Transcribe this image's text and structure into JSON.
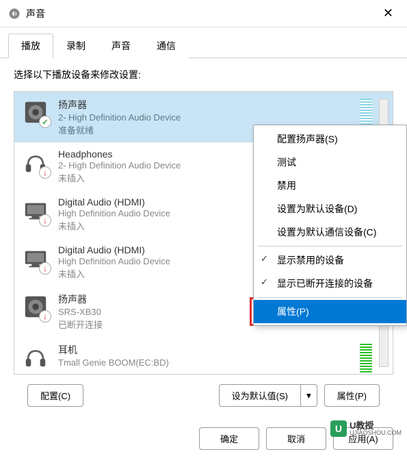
{
  "titlebar": {
    "title": "声音"
  },
  "tabs": [
    {
      "label": "播放",
      "active": true
    },
    {
      "label": "录制",
      "active": false
    },
    {
      "label": "声音",
      "active": false
    },
    {
      "label": "通信",
      "active": false
    }
  ],
  "instruction": "选择以下播放设备来修改设置:",
  "devices": [
    {
      "name": "扬声器",
      "desc": "2- High Definition Audio Device",
      "status": "准备就绪",
      "selected": true,
      "icon": "speaker",
      "level": "cyan",
      "badge": "green"
    },
    {
      "name": "Headphones",
      "desc": "2- High Definition Audio Device",
      "status": "未插入",
      "selected": false,
      "icon": "headphones",
      "level": null,
      "badge": "red"
    },
    {
      "name": "Digital Audio (HDMI)",
      "desc": "High Definition Audio Device",
      "status": "未插入",
      "selected": false,
      "icon": "monitor",
      "level": null,
      "badge": "red"
    },
    {
      "name": "Digital Audio (HDMI)",
      "desc": "High Definition Audio Device",
      "status": "未插入",
      "selected": false,
      "icon": "monitor",
      "level": null,
      "badge": "red"
    },
    {
      "name": "扬声器",
      "desc": "SRS-XB30",
      "status": "已断开连接",
      "selected": false,
      "icon": "speaker",
      "level": null,
      "badge": "red"
    },
    {
      "name": "耳机",
      "desc": "Tmall Genie BOOM(EC:BD)",
      "status": "",
      "selected": false,
      "icon": "headphones",
      "level": "green",
      "badge": null
    }
  ],
  "context_menu": {
    "items": [
      {
        "label": "配置扬声器(S)",
        "type": "item"
      },
      {
        "label": "测试",
        "type": "item"
      },
      {
        "label": "禁用",
        "type": "item"
      },
      {
        "label": "设置为默认设备(D)",
        "type": "item"
      },
      {
        "label": "设置为默认通信设备(C)",
        "type": "item"
      },
      {
        "type": "sep"
      },
      {
        "label": "显示禁用的设备",
        "type": "item",
        "checked": true
      },
      {
        "label": "显示已断开连接的设备",
        "type": "item",
        "checked": true
      },
      {
        "type": "sep"
      },
      {
        "label": "属性(P)",
        "type": "item",
        "highlighted": true
      }
    ]
  },
  "bottom": {
    "configure": "配置(C)",
    "set_default": "设为默认值(S)",
    "properties": "属性(P)"
  },
  "dialog": {
    "ok": "确定",
    "cancel": "取消",
    "apply": "应用(A)"
  },
  "watermark": {
    "brand": "U教授",
    "url": "UJIAOSHOU.COM"
  }
}
